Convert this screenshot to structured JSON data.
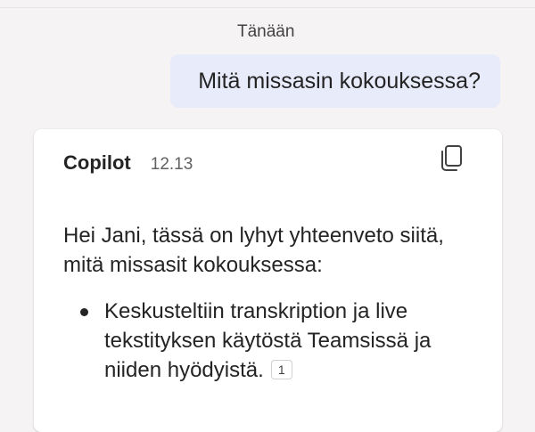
{
  "date_divider": "Tänään",
  "user_message": "Mitä missasin kokouksessa?",
  "bot_message": {
    "sender": "Copilot",
    "time": "12.13",
    "copy_icon": "copy-icon",
    "intro": "Hei Jani, tässä on lyhyt yhteenveto siitä, mitä missasit kokouksessa:",
    "bullets": [
      {
        "text": "Keskusteltiin transkription ja live tekstityksen käytöstä Teamsissä ja niiden hyödyistä.",
        "citation": "1"
      }
    ]
  }
}
